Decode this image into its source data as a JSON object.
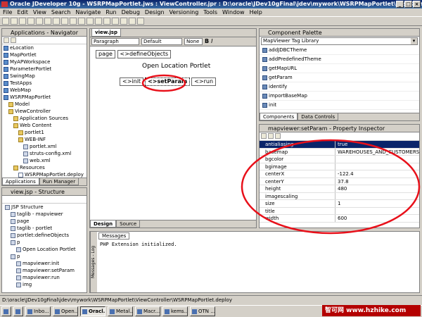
{
  "window": {
    "title": "Oracle JDeveloper 10g - WSRPMapPortlet.jws : ViewController.jpr : D:\\oracle\\JDev10gFinal\\jdev\\mywork\\WSRPMapPortlet\\ViewController\\public_html\\portlet1\\html..."
  },
  "menu": [
    "File",
    "Edit",
    "View",
    "Search",
    "Navigate",
    "Run",
    "Debug",
    "Design",
    "Versioning",
    "Tools",
    "Window",
    "Help"
  ],
  "navigator": {
    "title": "Applications - Navigator",
    "items": [
      "eLocation",
      "MapPortlet",
      "MyAPWorkspace",
      "ParameterPortlet",
      "SwingMap",
      "TestApps",
      "WebMap",
      "WSRPMapPortlet",
      "Model",
      "ViewController",
      "Application Sources",
      "Web Content",
      "portlet1",
      "WEB-INF",
      "portlet.xml",
      "struts-config.xml",
      "web.xml",
      "Resources",
      "WSRPMapPortlet.deploy"
    ],
    "tabs": [
      "Applications",
      "Run Manager"
    ]
  },
  "structure": {
    "title": "view.jsp - Structure",
    "items": [
      "JSP Structure",
      "taglib - mapviewer",
      "page",
      "taglib - portlet",
      "portlet:defineObjects",
      "p",
      "Open Location Portlet",
      "p",
      "mapviewer:init",
      "mapviewer:setParam",
      "mapviewer:run",
      "img"
    ]
  },
  "editor": {
    "tab": "view.jsp",
    "paragraph": "Paragraph",
    "font": "Default",
    "size": "None",
    "page_tag": "page",
    "define_tag": "<>defineObjects",
    "heading": "Open Location Portlet",
    "init_tag": "<>init",
    "setparam_tag": "<>setParam",
    "run_tag": "<>run",
    "bottom_tabs": [
      "Design",
      "Source"
    ]
  },
  "messages": {
    "tab": "Messages",
    "side_label": "Messages - Log",
    "text": "PHP Extension initialized."
  },
  "palette": {
    "title": "Component Palette",
    "library": "MapViewer Tag Library",
    "items": [
      "addJDBCTheme",
      "addPredefinedTheme",
      "getMapURL",
      "getParam",
      "identify",
      "importBaseMap",
      "init"
    ],
    "tabs": [
      "Components",
      "Data Controls"
    ]
  },
  "inspector": {
    "title": "mapviewer:setParam - Property Inspector",
    "rows": [
      {
        "name": "antialiasing",
        "value": "true"
      },
      {
        "name": "basemap",
        "value": "WAREHOUSES_AND_CUSTOMERS"
      },
      {
        "name": "bgcolor",
        "value": ""
      },
      {
        "name": "bgimage",
        "value": ""
      },
      {
        "name": "centerX",
        "value": "-122.4"
      },
      {
        "name": "centerY",
        "value": "37.8"
      },
      {
        "name": "height",
        "value": "480"
      },
      {
        "name": "imagescaling",
        "value": ""
      },
      {
        "name": "size",
        "value": "1"
      },
      {
        "name": "title",
        "value": ""
      },
      {
        "name": "width",
        "value": "600"
      }
    ]
  },
  "statusbar": {
    "text": "D:\\oracle\\JDev10gFinal\\jdev\\mywork\\WSRPMapPortlet\\ViewController\\WSRPMapPortlet.deploy"
  },
  "taskbar": {
    "items": [
      "",
      "",
      "Inbo...",
      "Open...",
      "Oracl...",
      "Metal...",
      "Macr...",
      "kems...",
      "OTN ..."
    ]
  },
  "watermark": "智可网 www.hzhike.com",
  "colors": {
    "annotation": "#e8101a",
    "selection": "#0a246a",
    "titlebar": "#0a246a"
  }
}
